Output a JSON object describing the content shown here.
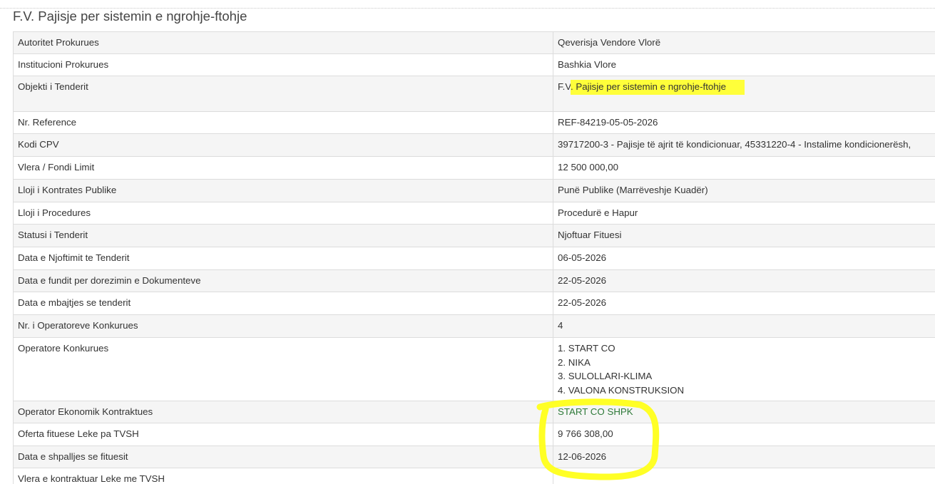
{
  "page": {
    "title": "F.V. Pajisje per sistemin e ngrohje-ftohje"
  },
  "fields": {
    "autoriteti": {
      "label": "Autoritet Prokurues",
      "value": "Qeverisja Vendore Vlorë"
    },
    "institucioni": {
      "label": "Institucioni Prokurues",
      "value": "Bashkia Vlore"
    },
    "objekti": {
      "label": "Objekti i Tenderit",
      "value_prefix": "F.V",
      "value_highlight": ". Pajisje per sistemin e ngrohje-ftohje"
    },
    "reference": {
      "label": "Nr. Reference",
      "value": "REF-84219-05-05-2026"
    },
    "cpv": {
      "label": "Kodi CPV",
      "value": "39717200-3 - Pajisje të ajrit të kondicionuar, 45331220-4 - Instalime kondicionerësh,"
    },
    "vlera": {
      "label": "Vlera / Fondi Limit",
      "value": "12 500 000,00"
    },
    "lloji_kontrates": {
      "label": "Lloji i Kontrates Publike",
      "value": "Punë Publike (Marrëveshje Kuadër)"
    },
    "lloji_procedures": {
      "label": "Lloji i Procedures",
      "value": "Procedurë e Hapur"
    },
    "statusi": {
      "label": "Statusi i Tenderit",
      "value": "Njoftuar Fituesi"
    },
    "data_njoftimit": {
      "label": "Data e Njoftimit te Tenderit",
      "value": "06-05-2026"
    },
    "data_dorezimit": {
      "label": "Data e fundit per dorezimin e Dokumenteve",
      "value": "22-05-2026"
    },
    "data_mbajtjes": {
      "label": "Data e mbajtjes se tenderit",
      "value": "22-05-2026"
    },
    "nr_operatoreve": {
      "label": "Nr. i Operatoreve Konkurues",
      "value": "4"
    },
    "operatoret": {
      "label": "Operatore Konkurues",
      "items": [
        "1. START CO",
        "2. NIKA",
        "3. SULOLLARI-KLIMA",
        "4. VALONA KONSTRUKSION"
      ]
    },
    "operator_kontraktues": {
      "label": "Operator Ekonomik Kontraktues",
      "value": "START CO SHPK"
    },
    "oferta_fituese": {
      "label": "Oferta fituese Leke pa TVSH",
      "value": "9 766 308,00"
    },
    "data_shpalljes": {
      "label": "Data e shpalljes se fituesit",
      "value": "12-06-2026"
    },
    "vlera_kontraktuar": {
      "label": "Vlera e kontraktuar Leke me TVSH",
      "value": ""
    }
  },
  "colors": {
    "highlight": "#ffff3a",
    "annotation_circle": "#ffff1a",
    "winner_text": "#2f7a3a"
  }
}
